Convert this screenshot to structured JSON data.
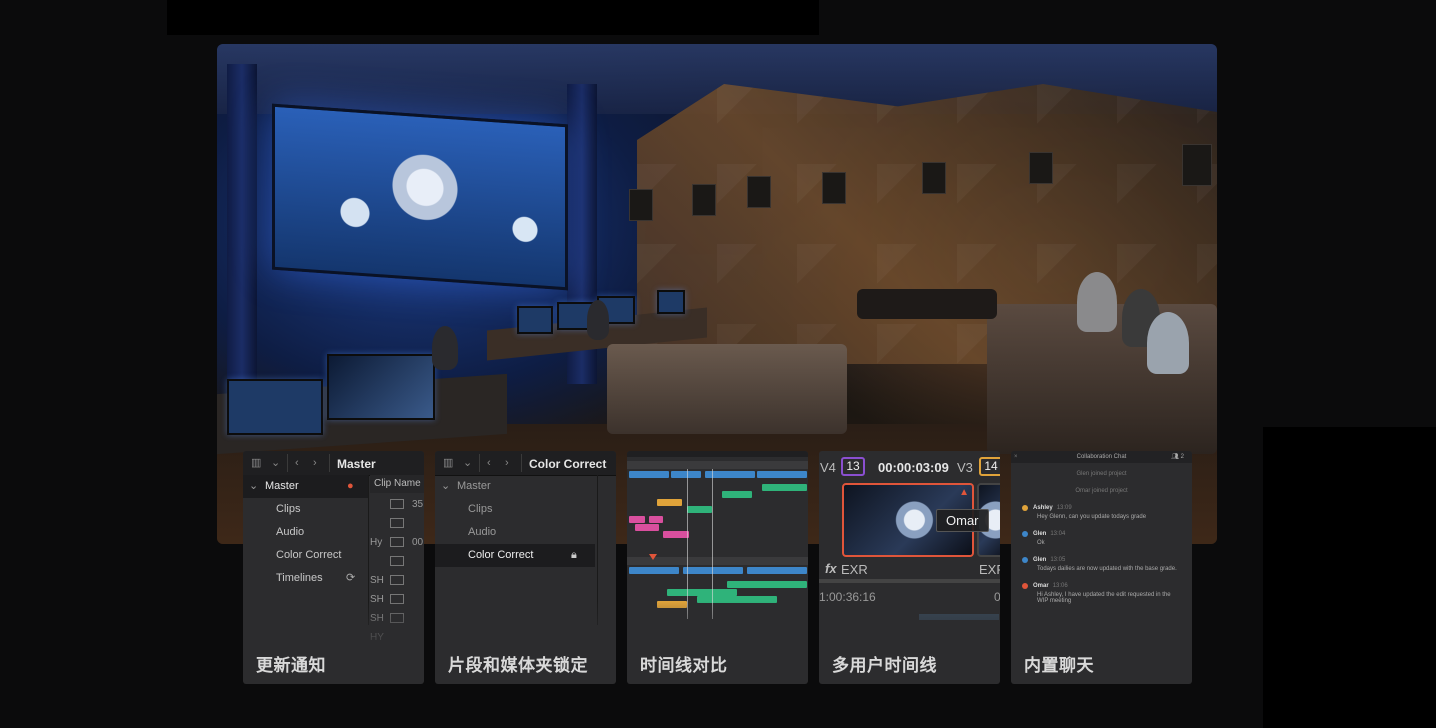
{
  "colors": {
    "background": "#0b0b0c",
    "card": "#2c2c2e",
    "accent_red": "#e0553a",
    "timeline_green": "#2fb37a",
    "timeline_blue": "#3d86c9",
    "timeline_pink": "#d94f9e",
    "timeline_orange": "#e0a33a"
  },
  "card1": {
    "caption": "更新通知",
    "header_title": "Master",
    "tree": [
      {
        "label": "Master",
        "icon": "user-icon"
      },
      {
        "label": "Clips"
      },
      {
        "label": "Audio"
      },
      {
        "label": "Color Correct"
      },
      {
        "label": "Timelines",
        "icon": "refresh-icon"
      }
    ],
    "column_header": "Clip Name",
    "clips": [
      "35",
      "Hy",
      "00",
      "SH",
      "SH",
      "SH",
      "HY"
    ]
  },
  "card2": {
    "caption": "片段和媒体夹锁定",
    "header_title": "Color Correct",
    "tree": [
      {
        "label": "Master"
      },
      {
        "label": "Clips"
      },
      {
        "label": "Audio"
      },
      {
        "label": "Color Correct",
        "icon": "lock-icon"
      }
    ]
  },
  "card3": {
    "caption": "时间线对比"
  },
  "card4": {
    "caption": "多用户时间线",
    "track_left": "V4",
    "badge_left": "13",
    "timecode": "00:00:03:09",
    "track_right": "V3",
    "badge_right": "14",
    "tooltip_user": "Omar",
    "fx_label": "fx",
    "format_label": "EXR",
    "format_label_right": "EXR",
    "timecode2": "1:00:36:16",
    "zero": "0"
  },
  "card5": {
    "caption": "内置聊天",
    "chat_title": "Collaboration Chat",
    "user_count": "2",
    "system": [
      "Glen joined project",
      "Omar joined project"
    ],
    "messages": [
      {
        "user": "Ashley",
        "time": "13:09",
        "text": "Hey Glenn, can you update todays grade",
        "color": "#e0a33a"
      },
      {
        "user": "Glen",
        "time": "13:04",
        "text": "Ok",
        "color": "#3d86c9"
      },
      {
        "user": "Glen",
        "time": "13:05",
        "text": "Todays dailies are now updated with the base grade.",
        "color": "#3d86c9"
      },
      {
        "user": "Omar",
        "time": "13:06",
        "text": "Hi Ashley, I have updated the edit requested in the WIP meeting",
        "color": "#e0553a"
      }
    ]
  }
}
